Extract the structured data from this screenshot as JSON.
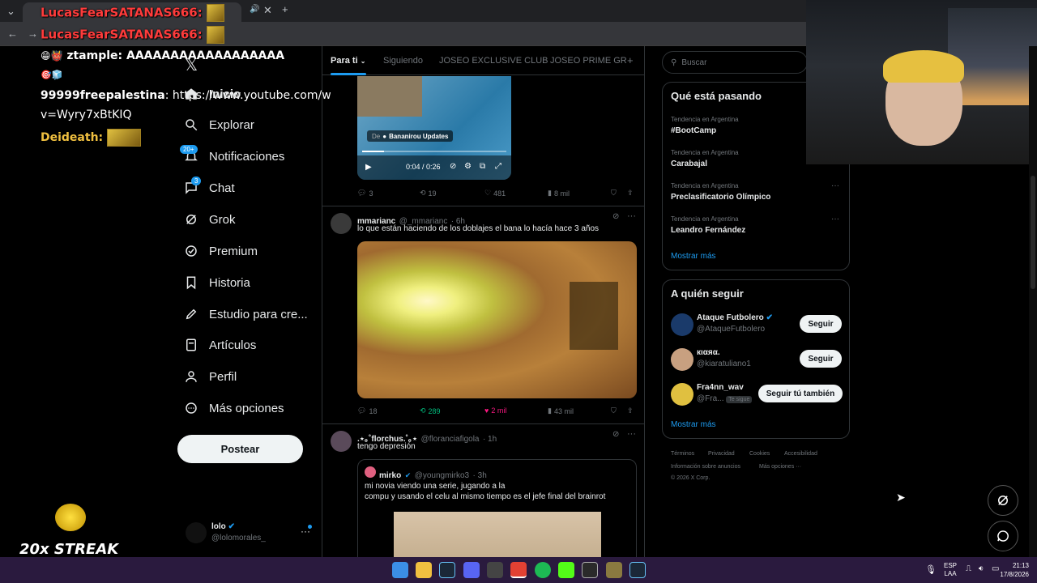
{
  "browser": {
    "tab_title": "LucasFearSATANAS666:",
    "new_tab": "+",
    "address_overlay": "LucasFearSATANAS666:"
  },
  "chat_overlay": {
    "line1_user": "ztample",
    "line1_text": ": AAAAAAAAAAAAAAAAAA",
    "line2_user": "99999freepalestina",
    "line2_text": ": https://www.youtube.com/w",
    "line3_text": "v=Wyry7xBtKIQ",
    "line4_user": "Deideath",
    "line4_text": ":",
    "streak": "20x STREAK"
  },
  "sidebar": {
    "items": [
      {
        "label": "Inicio",
        "icon": "home-icon"
      },
      {
        "label": "Explorar",
        "icon": "search-icon"
      },
      {
        "label": "Notificaciones",
        "icon": "bell-icon",
        "badge": "20+"
      },
      {
        "label": "Chat",
        "icon": "chat-icon",
        "badge": "3"
      },
      {
        "label": "Grok",
        "icon": "grok-icon"
      },
      {
        "label": "Premium",
        "icon": "premium-icon"
      },
      {
        "label": "Historia",
        "icon": "bookmark-icon"
      },
      {
        "label": "Estudio para cre...",
        "icon": "rocket-icon"
      },
      {
        "label": "Artículos",
        "icon": "article-icon"
      },
      {
        "label": "Perfil",
        "icon": "user-icon"
      },
      {
        "label": "Más opciones",
        "icon": "more-icon"
      }
    ],
    "post_button": "Postear",
    "account_name": "lolo",
    "account_handle": "@lolomorales_"
  },
  "timeline": {
    "tabs": [
      "Para ti",
      "Siguiendo",
      "JOSEO EXCLUSIVE CLUB",
      "JOSEO PRIME GR"
    ],
    "add_tab": "+",
    "tweet1": {
      "source_label": "De",
      "source_name": "Bananirou Updates",
      "video_time": "0:04 / 0:26",
      "replies": "3",
      "retweets": "19",
      "likes": "481",
      "views": "8 mil"
    },
    "tweet2": {
      "name": "mmarianc",
      "handle": "@_mmarianc",
      "time": "· 6h",
      "text": "lo que están haciendo de los doblajes el bana lo hacía hace 3 años",
      "replies": "18",
      "retweets": "289",
      "likes": "2 mil",
      "views": "43 mil"
    },
    "tweet3": {
      "name": ".⋆｡˚florchus.˚｡⋆",
      "handle": "@floranciafigola",
      "time": "· 1h",
      "text": "tengo depresión",
      "quote_name": "mirko",
      "quote_handle": "@youngmirko3",
      "quote_time": "· 3h",
      "quote_text_1": "mi novia viendo una serie, jugando a la",
      "quote_text_2": "compu y usando el celu al mismo tiempo es el jefe final del brainrot"
    }
  },
  "right": {
    "search_placeholder": "Buscar",
    "trends_title": "Qué está pasando",
    "trends": [
      {
        "category": "Tendencia en Argentina",
        "name": "#BootCamp"
      },
      {
        "category": "Tendencia en Argentina",
        "name": "Carabajal"
      },
      {
        "category": "Tendencia en Argentina",
        "name": "Preclasificatorio Olímpico"
      },
      {
        "category": "Tendencia en Argentina",
        "name": "Leandro Fernández"
      }
    ],
    "show_more": "Mostrar más",
    "follow_title": "A quién seguir",
    "follow": [
      {
        "name": "Ataque Futbolero",
        "handle": "@AtaqueFutbolero",
        "button": "Seguir"
      },
      {
        "name": "кιαяα.",
        "handle": "@kiaratuliano1",
        "button": "Seguir"
      },
      {
        "name": "Fra4nn_wav",
        "handle": "@Fra...",
        "tag": "Te sigue",
        "button": "Seguir tú también"
      }
    ],
    "follow_more": "Mostrar más",
    "footer": [
      "Términos",
      "Privacidad",
      "Cookies",
      "Accesibilidad",
      "Información sobre anuncios",
      "Más opciones ···",
      "© 2026 X Corp."
    ]
  },
  "taskbar": {
    "lang1": "ESP",
    "lang2": "LAA",
    "time": "21:13",
    "date": "17/8/2026"
  }
}
